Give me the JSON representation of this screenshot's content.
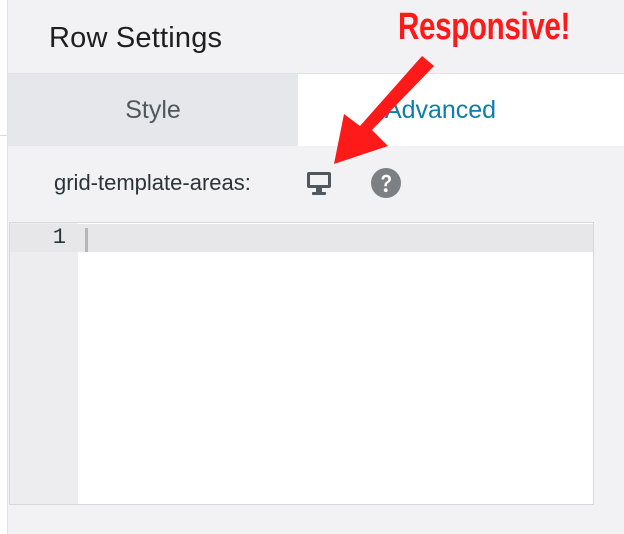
{
  "panel": {
    "title": "Row Settings"
  },
  "tabs": [
    {
      "label": "Style",
      "active": false
    },
    {
      "label": "Advanced",
      "active": true
    }
  ],
  "field": {
    "label": "grid-template-areas:",
    "device_icon": "desktop-monitor-icon",
    "help_icon": "question-circle-icon"
  },
  "editor": {
    "line_numbers": [
      "1"
    ],
    "value": ""
  },
  "annotation": {
    "text": "Responsive!",
    "color": "#ff1a1a"
  },
  "colors": {
    "accent": "#0a7fa8",
    "panel_bg": "#f2f2f4",
    "inactive_tab_bg": "#e6e7ea"
  }
}
